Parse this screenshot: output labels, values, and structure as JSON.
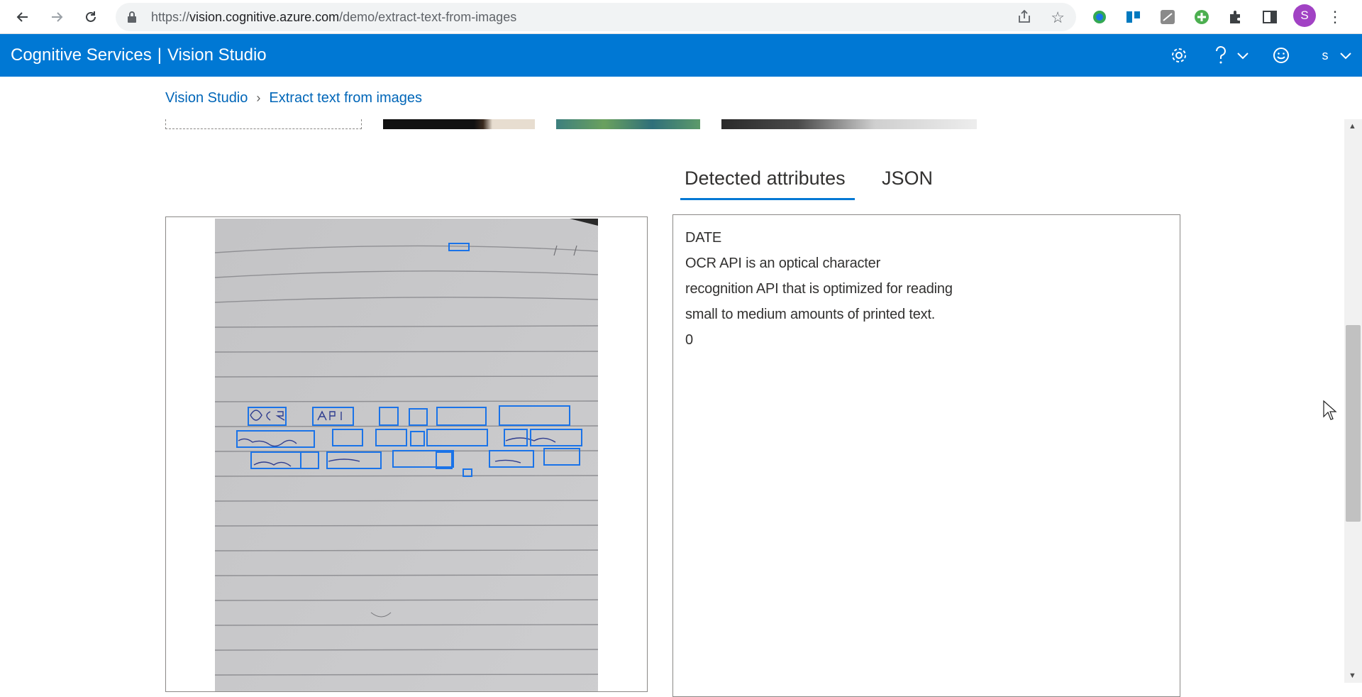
{
  "browser": {
    "url_scheme": "https://",
    "url_host": "vision.cognitive.azure.com",
    "url_path": "/demo/extract-text-from-images",
    "profile_initial": "S",
    "icons": [
      "back-icon",
      "forward-icon",
      "reload-icon",
      "lock-icon",
      "share-icon",
      "star-icon",
      "extension-icons",
      "puzzle-icon",
      "side-panel-icon",
      "kebab-icon"
    ]
  },
  "header": {
    "product": "Cognitive Services",
    "separator": "|",
    "studio": "Vision Studio",
    "user_initial": "s",
    "background_color": "#0078d4"
  },
  "breadcrumb": {
    "items": [
      {
        "label": "Vision Studio"
      },
      {
        "label": "Extract text from images"
      }
    ]
  },
  "tabs": [
    {
      "label": "Detected attributes",
      "selected": true
    },
    {
      "label": "JSON",
      "selected": false
    }
  ],
  "results": {
    "lines": [
      "DATE",
      "OCR API is an optical character",
      "recognition API that is optimized for reading",
      "small to medium amounts of printed text.",
      "0"
    ]
  }
}
